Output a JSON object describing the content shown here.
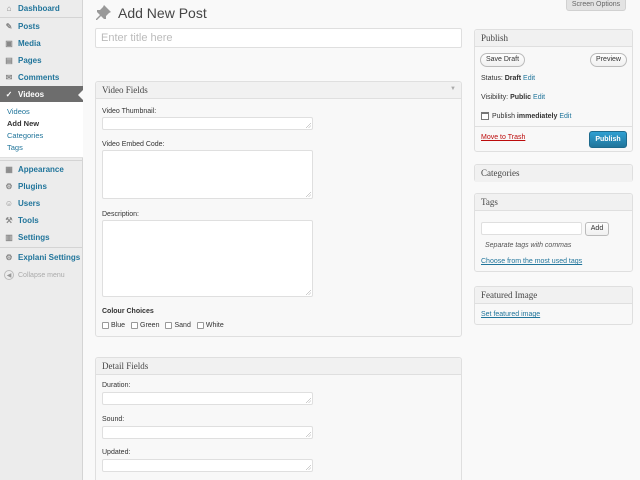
{
  "sidebar": {
    "items": [
      {
        "label": "Dashboard",
        "icon": "dashboard-icon",
        "glyph": "⌂"
      },
      {
        "label": "Posts",
        "icon": "posts-icon",
        "glyph": "✎"
      },
      {
        "label": "Media",
        "icon": "media-icon",
        "glyph": "▣"
      },
      {
        "label": "Pages",
        "icon": "pages-icon",
        "glyph": "▤"
      },
      {
        "label": "Comments",
        "icon": "comments-icon",
        "glyph": "✉"
      },
      {
        "label": "Videos",
        "icon": "videos-icon",
        "glyph": "✓"
      },
      {
        "label": "Appearance",
        "icon": "appearance-icon",
        "glyph": "▦"
      },
      {
        "label": "Plugins",
        "icon": "plugins-icon",
        "glyph": "⚙"
      },
      {
        "label": "Users",
        "icon": "users-icon",
        "glyph": "☺"
      },
      {
        "label": "Tools",
        "icon": "tools-icon",
        "glyph": "⚒"
      },
      {
        "label": "Settings",
        "icon": "settings-icon",
        "glyph": "▥"
      },
      {
        "label": "Explani Settings",
        "icon": "explani-settings-icon",
        "glyph": "⚙"
      }
    ],
    "submenu": [
      "Videos",
      "Add New",
      "Categories",
      "Tags"
    ],
    "collapse_label": "Collapse menu"
  },
  "header": {
    "screen_options": "Screen Options",
    "title": "Add New Post",
    "title_icon": "pushpin-icon",
    "title_placeholder": "Enter title here"
  },
  "video_fields": {
    "heading": "Video Fields",
    "thumbnail_label": "Video Thumbnail:",
    "embed_label": "Video Embed Code:",
    "description_label": "Description:",
    "colour_heading": "Colour Choices",
    "colours": [
      "Blue",
      "Green",
      "Sand",
      "White"
    ]
  },
  "detail_fields": {
    "heading": "Detail Fields",
    "duration_label": "Duration:",
    "sound_label": "Sound:",
    "updated_label": "Updated:"
  },
  "publish": {
    "heading": "Publish",
    "save_draft": "Save Draft",
    "preview": "Preview",
    "status_label": "Status:",
    "status_value": "Draft",
    "visibility_label": "Visibility:",
    "visibility_value": "Public",
    "publish_label": "Publish",
    "publish_value": "immediately",
    "edit": "Edit",
    "trash": "Move to Trash",
    "publish_button": "Publish"
  },
  "categories": {
    "heading": "Categories"
  },
  "tags": {
    "heading": "Tags",
    "add_button": "Add",
    "hint": "Separate tags with commas",
    "most_used": "Choose from the most used tags"
  },
  "featured_image": {
    "heading": "Featured Image",
    "link": "Set featured image"
  },
  "colors": {
    "accent": "#21759b",
    "primary_button": "#21759b",
    "trash": "#bc0b0b",
    "active_menu": "#6d6d6d"
  }
}
